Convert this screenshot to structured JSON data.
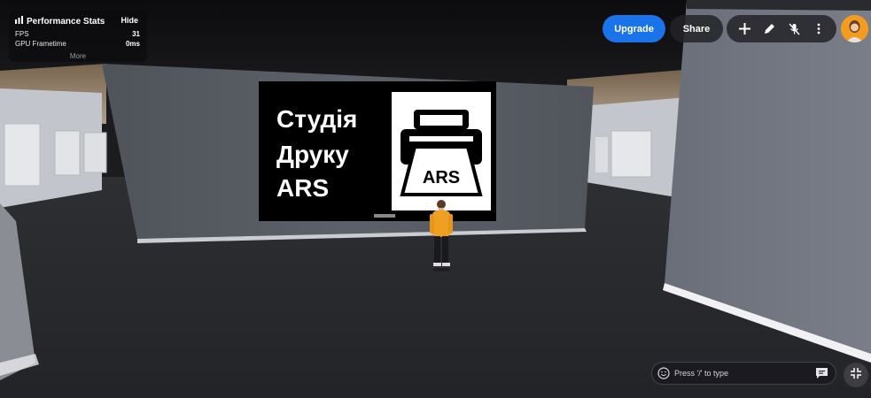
{
  "perf": {
    "title": "Performance Stats",
    "hide_label": "Hide",
    "rows": [
      {
        "label": "FPS",
        "value": "31"
      },
      {
        "label": "GPU Frametime",
        "value": "0ms"
      }
    ],
    "more_label": "More"
  },
  "toolbar": {
    "upgrade_label": "Upgrade",
    "share_label": "Share",
    "icons": [
      "plus-icon",
      "pencil-icon",
      "mic-off-icon",
      "more-vertical-icon"
    ]
  },
  "banner": {
    "line1": "Студія",
    "line2": "Друку",
    "line3": "ARS",
    "logo_text": "ARS"
  },
  "chat": {
    "placeholder": "Press '/' to type"
  },
  "colors": {
    "accent": "#1a73e8",
    "avatar_bg": "#f39c1f",
    "character_jacket": "#f0a020"
  }
}
